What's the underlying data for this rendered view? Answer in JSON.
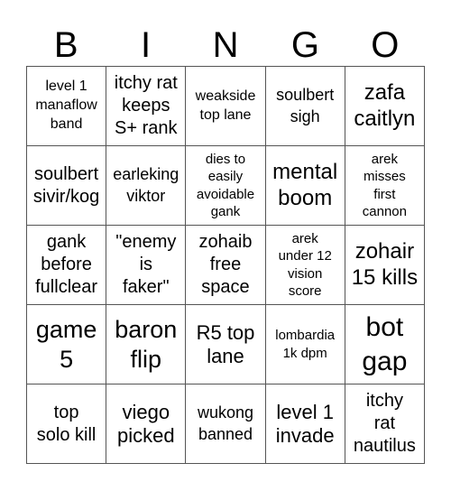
{
  "header": {
    "letters": [
      "B",
      "I",
      "N",
      "G",
      "O"
    ]
  },
  "cells": [
    "level 1\nmanaflow\nband",
    "itchy rat\nkeeps\nS+ rank",
    "weakside\ntop lane",
    "soulbert\nsigh",
    "zafa\ncaitlyn",
    "soulbert\nsivir/kog",
    "earleking\nviktor",
    "dies to\neasily\navoidable\ngank",
    "mental\nboom",
    "arek\nmisses\nfirst\ncannon",
    "gank\nbefore\nfullclear",
    "\"enemy\nis\nfaker\"",
    "zohaib\nfree\nspace",
    "arek\nunder 12\nvision\nscore",
    "zohair\n15 kills",
    "game\n5",
    "baron\nflip",
    "R5 top\nlane",
    "lombardia\n1k dpm",
    "bot\ngap",
    "top\nsolo kill",
    "viego\npicked",
    "wukong\nbanned",
    "level 1\ninvade",
    "itchy\nrat\nnautilus"
  ]
}
